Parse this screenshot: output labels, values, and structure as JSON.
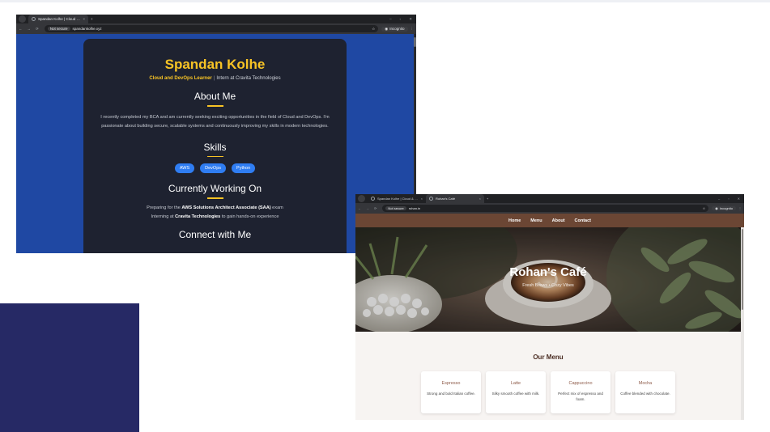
{
  "browser_portfolio": {
    "tab_title": "Spandan Kolhe | Cloud & Dev",
    "tab_close": "×",
    "new_tab": "+",
    "window_controls": [
      "–",
      "▫",
      "✕"
    ],
    "nav": {
      "back": "←",
      "forward": "→",
      "reload": "⟳"
    },
    "security_chip": "Not secure",
    "address": "spandankolhe.xyz",
    "incognito_label": "Incognito",
    "page": {
      "name": "Spandan Kolhe",
      "tagline_accent": "Cloud and DevOps Learner",
      "tagline_separator": "|",
      "tagline_rest": "Intern at Cravita Technologies",
      "about_heading": "About Me",
      "about_text": "I recently completed my BCA and am currently seeking exciting opportunities in the field of Cloud and DevOps. I'm passionate about building secure, scalable systems and continuously improving my skills in modern technologies.",
      "skills_heading": "Skills",
      "skills": [
        "AWS",
        "DevOps",
        "Python"
      ],
      "working_heading": "Currently Working On",
      "working_1_pre": "Preparing for the ",
      "working_1_bold": "AWS Solutions Architect Associate (SAA)",
      "working_1_post": " exam",
      "working_2_pre": "Interning at ",
      "working_2_bold": "Cravita Technologies",
      "working_2_post": " to gain hands-on experience",
      "connect_heading": "Connect with Me"
    }
  },
  "browser_cafe": {
    "tabs": [
      {
        "title": "Spandan Kolhe | Cloud & Dev"
      },
      {
        "title": "Rohan's Café"
      }
    ],
    "tab_close": "×",
    "new_tab": "+",
    "window_controls": [
      "–",
      "▫",
      "✕"
    ],
    "nav": {
      "back": "←",
      "forward": "→",
      "reload": "⟳"
    },
    "security_chip": "Not secure",
    "address": "rohan.in",
    "incognito_label": "Incognito",
    "page": {
      "nav_links": [
        "Home",
        "Menu",
        "About",
        "Contact"
      ],
      "hero_title": "Rohan's Café",
      "hero_subtitle": "Fresh Brews • Cozy Vibes",
      "menu_title": "Our Menu",
      "menu_items": [
        {
          "name": "Espresso",
          "desc": "Strong and bold Italian coffee."
        },
        {
          "name": "Latte",
          "desc": "Silky smooth coffee with milk."
        },
        {
          "name": "Cappuccino",
          "desc": "Perfect mix of espresso and foam."
        },
        {
          "name": "Mocha",
          "desc": "Coffee blended with chocolate."
        }
      ]
    }
  },
  "colors": {
    "portfolio_bg": "#1f48a3",
    "portfolio_card": "#1e2230",
    "portfolio_accent": "#f7c325",
    "skill_pill": "#2f7df2",
    "cafe_nav": "#6b4634",
    "cafe_heading": "#4a2c22",
    "cafe_item_name": "#8d5a48",
    "side_block": "#262965"
  }
}
